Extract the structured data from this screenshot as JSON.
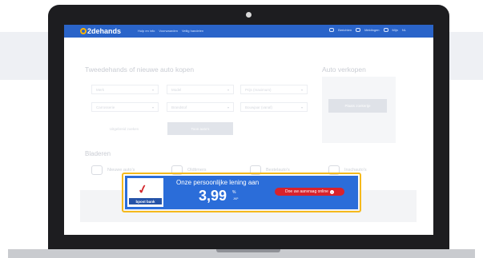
{
  "site": {
    "logo_text": "2dehands",
    "nav": [
      "Hulp en info",
      "Voorwaarden",
      "Veilig handelen"
    ],
    "actions": [
      "Berichten",
      "Meldingen",
      "Mijn",
      "NL"
    ]
  },
  "search": {
    "title": "Tweedehands of nieuwe auto kopen",
    "merk_placeholder": "Merk",
    "model_placeholder": "Model",
    "prijs_placeholder": "Prijs (maximum)",
    "carrosserie_placeholder": "Carrosserie",
    "brandstof_placeholder": "Brandstof",
    "bouwjaar_placeholder": "Bouwjaar (vanaf)",
    "advanced_link": "Uitgebreid zoeken",
    "submit_label": "Toon auto's"
  },
  "sell": {
    "title": "Auto verkopen",
    "button_label": "Plaats zoekertje"
  },
  "browse": {
    "title": "Bladeren",
    "categories": [
      {
        "label": "Nieuwe auto's",
        "icon": "new-car-icon"
      },
      {
        "label": "Oldtimers",
        "icon": "oldtimer-icon"
      },
      {
        "label": "Bestelauto's",
        "icon": "van-icon"
      },
      {
        "label": "Inschauto's",
        "icon": "crashed-car-icon"
      }
    ]
  },
  "ad": {
    "brand": "bpost bank",
    "headline": "Onze persoonlijke lening aan",
    "rate": "3,99",
    "rate_suffix": "%",
    "rate_sub": "JKP",
    "cta_label": "Doe uw aanvraag online",
    "highlight_color": "#f5b91c",
    "banner_color": "#2b6dd9",
    "cta_color": "#d8222b"
  }
}
